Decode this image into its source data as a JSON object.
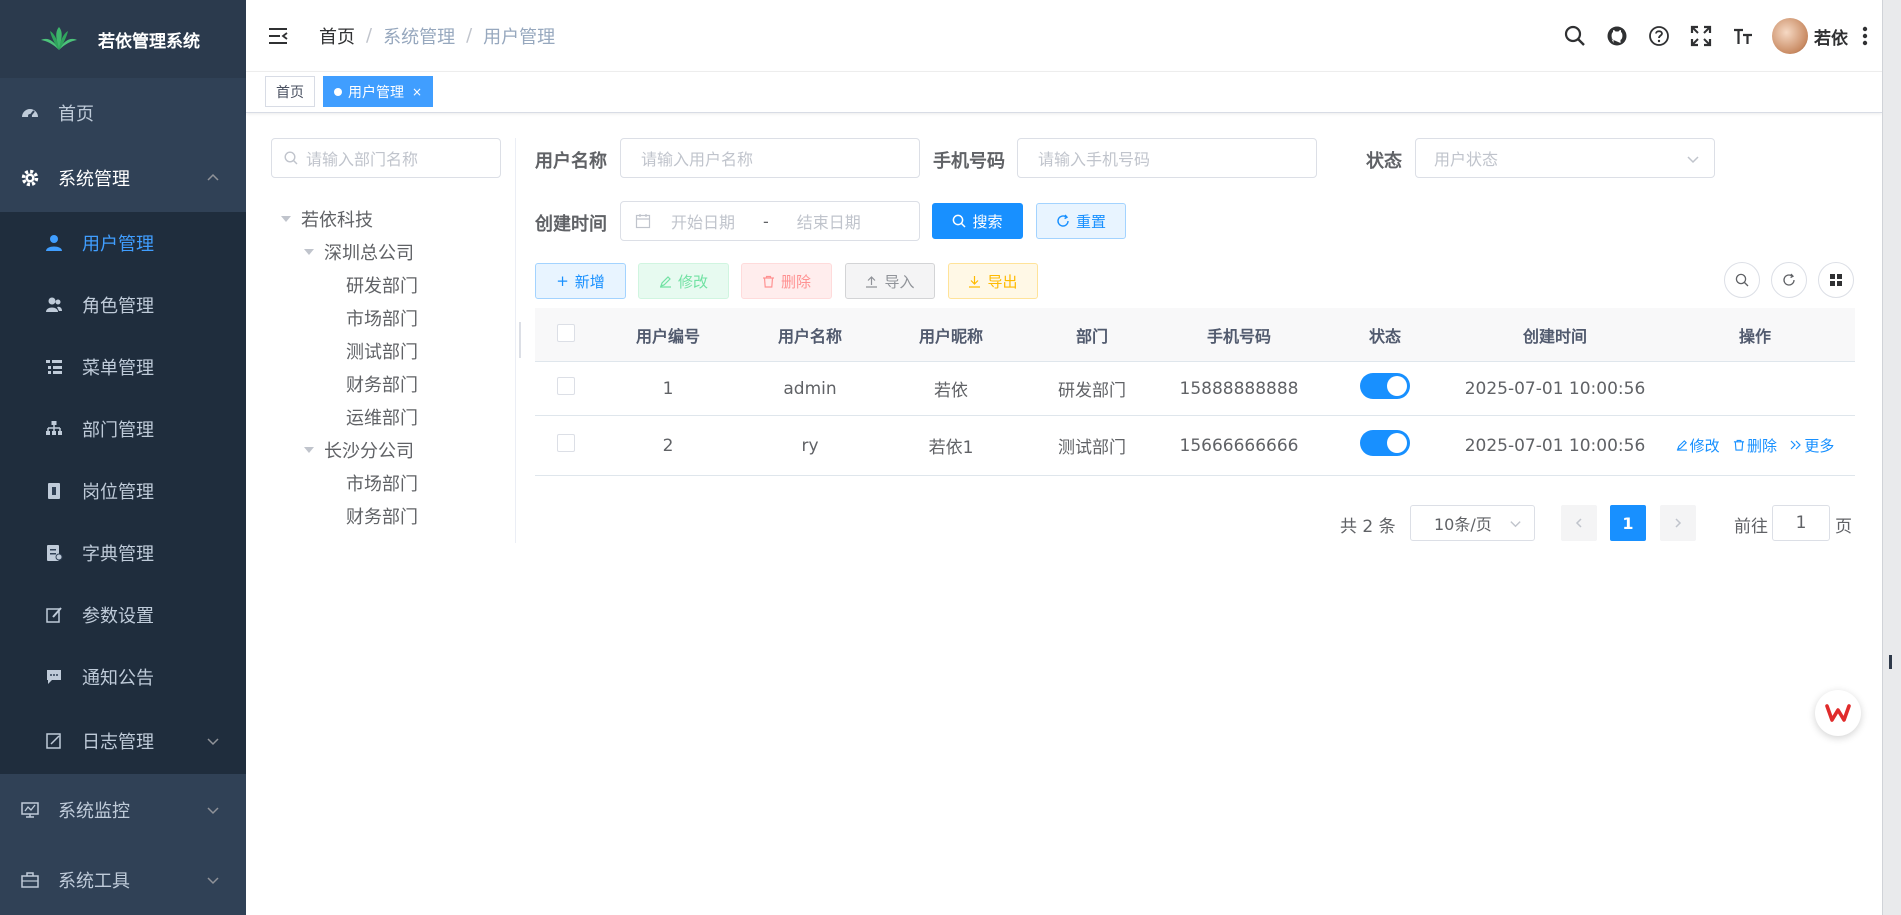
{
  "sidebar": {
    "logo_title": "若依管理系统",
    "items": [
      {
        "label": "首页",
        "icon": "dashboard-icon"
      },
      {
        "label": "系统管理",
        "icon": "gear-icon",
        "expanded": true
      },
      {
        "label": "系统监控",
        "icon": "monitor-icon"
      },
      {
        "label": "系统工具",
        "icon": "toolbox-icon"
      }
    ],
    "sub_items": [
      {
        "label": "用户管理",
        "icon": "user-icon",
        "active": true
      },
      {
        "label": "角色管理",
        "icon": "peoples-icon"
      },
      {
        "label": "菜单管理",
        "icon": "tree-table-icon"
      },
      {
        "label": "部门管理",
        "icon": "tree-icon"
      },
      {
        "label": "岗位管理",
        "icon": "post-icon"
      },
      {
        "label": "字典管理",
        "icon": "dict-icon"
      },
      {
        "label": "参数设置",
        "icon": "edit-icon"
      },
      {
        "label": "通知公告",
        "icon": "message-icon"
      },
      {
        "label": "日志管理",
        "icon": "log-icon"
      }
    ]
  },
  "navbar": {
    "breadcrumb": [
      "首页",
      "系统管理",
      "用户管理"
    ],
    "user_name": "若依"
  },
  "tags": [
    {
      "label": "首页",
      "active": false
    },
    {
      "label": "用户管理",
      "active": true
    }
  ],
  "dept": {
    "search_placeholder": "请输入部门名称",
    "tree": [
      {
        "label": "若依科技",
        "level": 0,
        "caret": true
      },
      {
        "label": "深圳总公司",
        "level": 1,
        "caret": true
      },
      {
        "label": "研发部门",
        "level": 2
      },
      {
        "label": "市场部门",
        "level": 2
      },
      {
        "label": "测试部门",
        "level": 2
      },
      {
        "label": "财务部门",
        "level": 2
      },
      {
        "label": "运维部门",
        "level": 2
      },
      {
        "label": "长沙分公司",
        "level": 1,
        "caret": true
      },
      {
        "label": "市场部门",
        "level": 2
      },
      {
        "label": "财务部门",
        "level": 2
      }
    ]
  },
  "form": {
    "username_label": "用户名称",
    "username_placeholder": "请输入用户名称",
    "phone_label": "手机号码",
    "phone_placeholder": "请输入手机号码",
    "status_label": "状态",
    "status_placeholder": "用户状态",
    "date_label": "创建时间",
    "date_start_placeholder": "开始日期",
    "date_sep": "-",
    "date_end_placeholder": "结束日期",
    "search_label": "搜索",
    "reset_label": "重置"
  },
  "toolbar": {
    "add_label": "新增",
    "edit_label": "修改",
    "delete_label": "删除",
    "import_label": "导入",
    "export_label": "导出"
  },
  "table": {
    "headers": [
      "用户编号",
      "用户名称",
      "用户昵称",
      "部门",
      "手机号码",
      "状态",
      "创建时间",
      "操作"
    ],
    "rows": [
      {
        "id": "1",
        "username": "admin",
        "nickname": "若依",
        "dept": "研发部门",
        "phone": "15888888888",
        "status": true,
        "created": "2025-07-01 10:00:56"
      },
      {
        "id": "2",
        "username": "ry",
        "nickname": "若依1",
        "dept": "测试部门",
        "phone": "15666666666",
        "status": true,
        "created": "2025-07-01 10:00:56"
      }
    ],
    "op_edit": "修改",
    "op_delete": "删除",
    "op_more": "更多"
  },
  "pagination": {
    "total_text": "共 2 条",
    "page_size": "10条/页",
    "current_page": "1",
    "goto_label": "前往",
    "goto_value": "1",
    "page_suffix": "页"
  },
  "colors": {
    "sidebar_bg": "#304156",
    "submenu_bg": "#1f2d3d",
    "primary": "#1890ff",
    "active_menu": "#409eff"
  }
}
